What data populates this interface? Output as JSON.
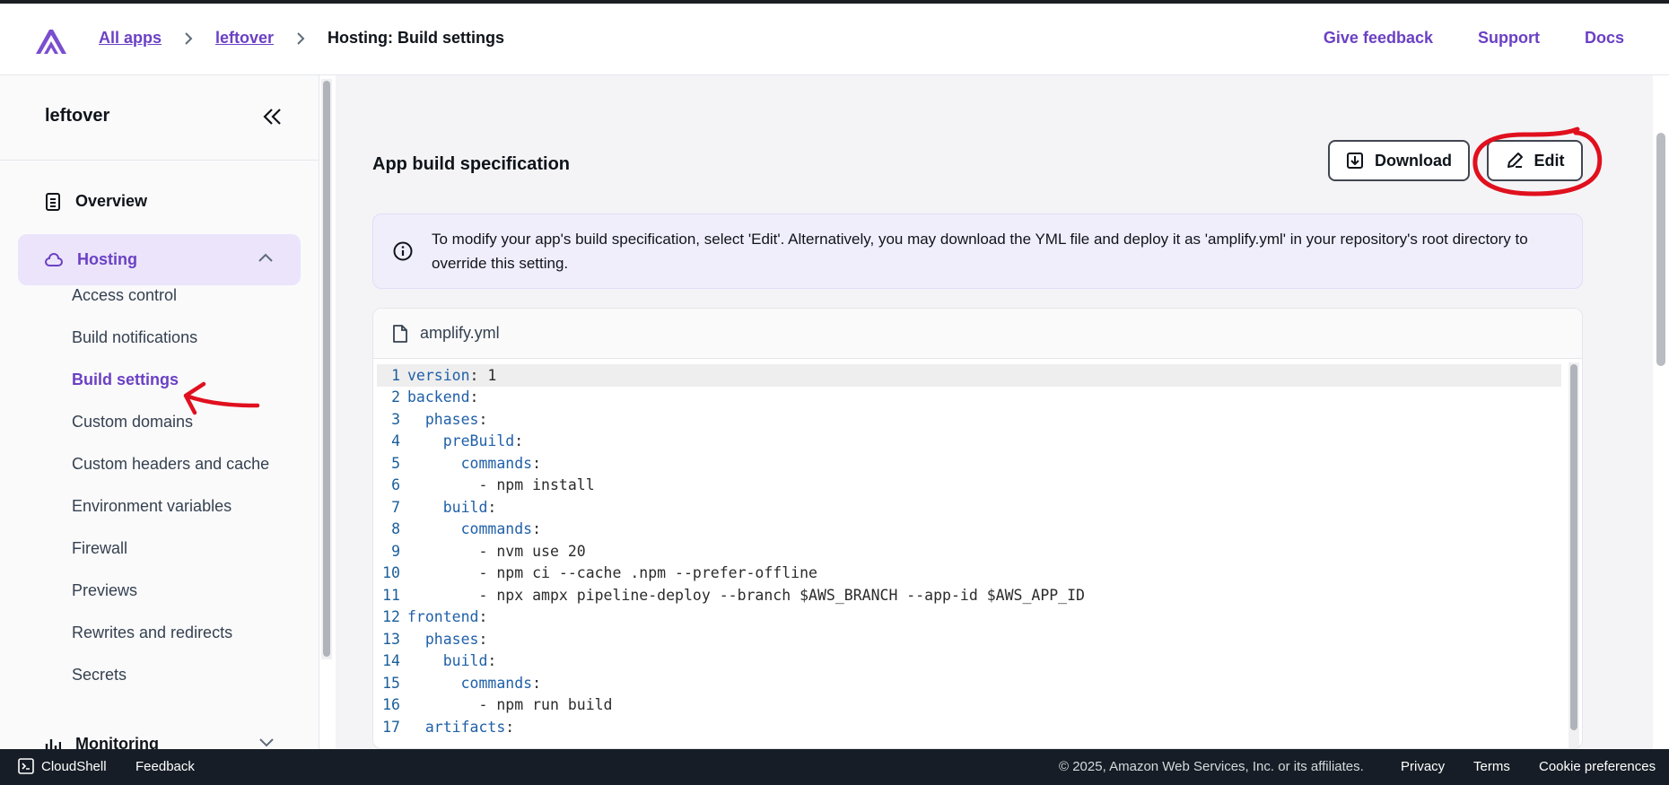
{
  "header": {
    "breadcrumbs": [
      "All apps",
      "leftover"
    ],
    "current_page": "Hosting: Build settings",
    "links": [
      "Give feedback",
      "Support",
      "Docs"
    ]
  },
  "sidebar": {
    "app_name": "leftover",
    "overview_label": "Overview",
    "hosting_label": "Hosting",
    "hosting_items": [
      "Access control",
      "Build notifications",
      "Build settings",
      "Custom domains",
      "Custom headers and cache",
      "Environment variables",
      "Firewall",
      "Previews",
      "Rewrites and redirects",
      "Secrets"
    ],
    "active_item": "Build settings",
    "monitoring_label": "Monitoring"
  },
  "main": {
    "section_title": "App build specification",
    "download_label": "Download",
    "edit_label": "Edit",
    "info_text": "To modify your app's build specification, select 'Edit'. Alternatively, you may download the YML file and deploy it as 'amplify.yml' in your repository's root directory to override this setting.",
    "file_name": "amplify.yml",
    "code_lines": [
      {
        "n": "1",
        "key": "version",
        "rest": ": 1",
        "indent": ""
      },
      {
        "n": "2",
        "key": "backend",
        "rest": ":",
        "indent": ""
      },
      {
        "n": "3",
        "key": "phases",
        "rest": ":",
        "indent": "  "
      },
      {
        "n": "4",
        "key": "preBuild",
        "rest": ":",
        "indent": "    "
      },
      {
        "n": "5",
        "key": "commands",
        "rest": ":",
        "indent": "      "
      },
      {
        "n": "6",
        "key": "",
        "rest": "- npm install",
        "indent": "        "
      },
      {
        "n": "7",
        "key": "build",
        "rest": ":",
        "indent": "    "
      },
      {
        "n": "8",
        "key": "commands",
        "rest": ":",
        "indent": "      "
      },
      {
        "n": "9",
        "key": "",
        "rest": "- nvm use 20",
        "indent": "        "
      },
      {
        "n": "10",
        "key": "",
        "rest": "- npm ci --cache .npm --prefer-offline",
        "indent": "        "
      },
      {
        "n": "11",
        "key": "",
        "rest": "- npx ampx pipeline-deploy --branch $AWS_BRANCH --app-id $AWS_APP_ID",
        "indent": "        "
      },
      {
        "n": "12",
        "key": "frontend",
        "rest": ":",
        "indent": ""
      },
      {
        "n": "13",
        "key": "phases",
        "rest": ":",
        "indent": "  "
      },
      {
        "n": "14",
        "key": "build",
        "rest": ":",
        "indent": "    "
      },
      {
        "n": "15",
        "key": "commands",
        "rest": ":",
        "indent": "      "
      },
      {
        "n": "16",
        "key": "",
        "rest": "- npm run build",
        "indent": "        "
      },
      {
        "n": "17",
        "key": "artifacts",
        "rest": ":",
        "indent": "  "
      }
    ]
  },
  "footer": {
    "cloudshell_label": "CloudShell",
    "feedback_label": "Feedback",
    "copyright": "© 2025, Amazon Web Services, Inc. or its affiliates.",
    "links": [
      "Privacy",
      "Terms",
      "Cookie preferences"
    ]
  },
  "colors": {
    "accent": "#6b40c4",
    "active_bg": "#ebe4fb",
    "footer_bg": "#161d26",
    "annotation_red": "#e0101e"
  },
  "icons": [
    "amplify-logo-icon",
    "chevron-right-icon",
    "double-chevron-left-icon",
    "document-icon",
    "cloud-icon",
    "chevron-up-icon",
    "chevron-down-icon",
    "download-icon",
    "pencil-icon",
    "info-icon",
    "file-icon",
    "cloudshell-icon",
    "monitoring-icon"
  ]
}
